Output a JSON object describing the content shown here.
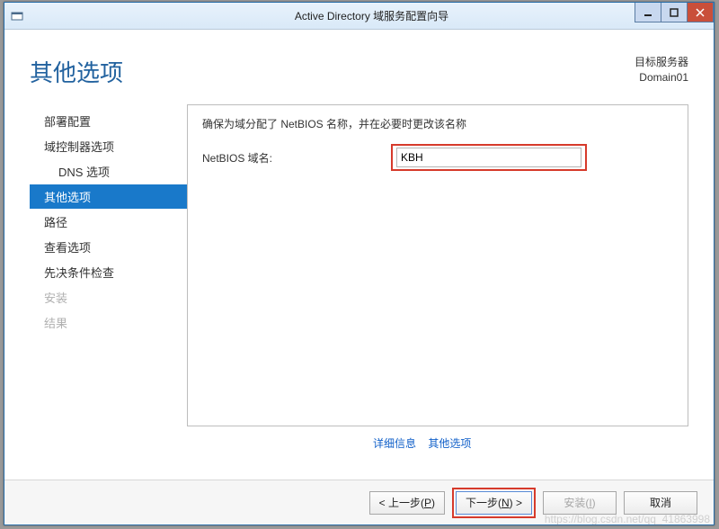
{
  "titlebar": {
    "title": "Active Directory 域服务配置向导"
  },
  "header": {
    "page_title": "其他选项",
    "target_label": "目标服务器",
    "target_value": "Domain01"
  },
  "sidebar": {
    "items": [
      {
        "label": "部署配置",
        "state": "normal",
        "indent": false
      },
      {
        "label": "域控制器选项",
        "state": "normal",
        "indent": false
      },
      {
        "label": "DNS 选项",
        "state": "normal",
        "indent": true
      },
      {
        "label": "其他选项",
        "state": "selected",
        "indent": false
      },
      {
        "label": "路径",
        "state": "normal",
        "indent": false
      },
      {
        "label": "查看选项",
        "state": "normal",
        "indent": false
      },
      {
        "label": "先决条件检查",
        "state": "normal",
        "indent": false
      },
      {
        "label": "安装",
        "state": "disabled",
        "indent": false
      },
      {
        "label": "结果",
        "state": "disabled",
        "indent": false
      }
    ]
  },
  "main": {
    "instruction": "确保为域分配了 NetBIOS 名称，并在必要时更改该名称",
    "field_label": "NetBIOS 域名:",
    "field_value": "KBH"
  },
  "links": {
    "more": "详细信息",
    "topic": "其他选项"
  },
  "footer": {
    "prev_pre": "< 上一步(",
    "prev_key": "P",
    "prev_post": ")",
    "next_pre": "下一步(",
    "next_key": "N",
    "next_post": ") >",
    "install_pre": "安装(",
    "install_key": "I",
    "install_post": ")",
    "cancel": "取消"
  },
  "watermark": "https://blog.csdn.net/qq_41863998"
}
